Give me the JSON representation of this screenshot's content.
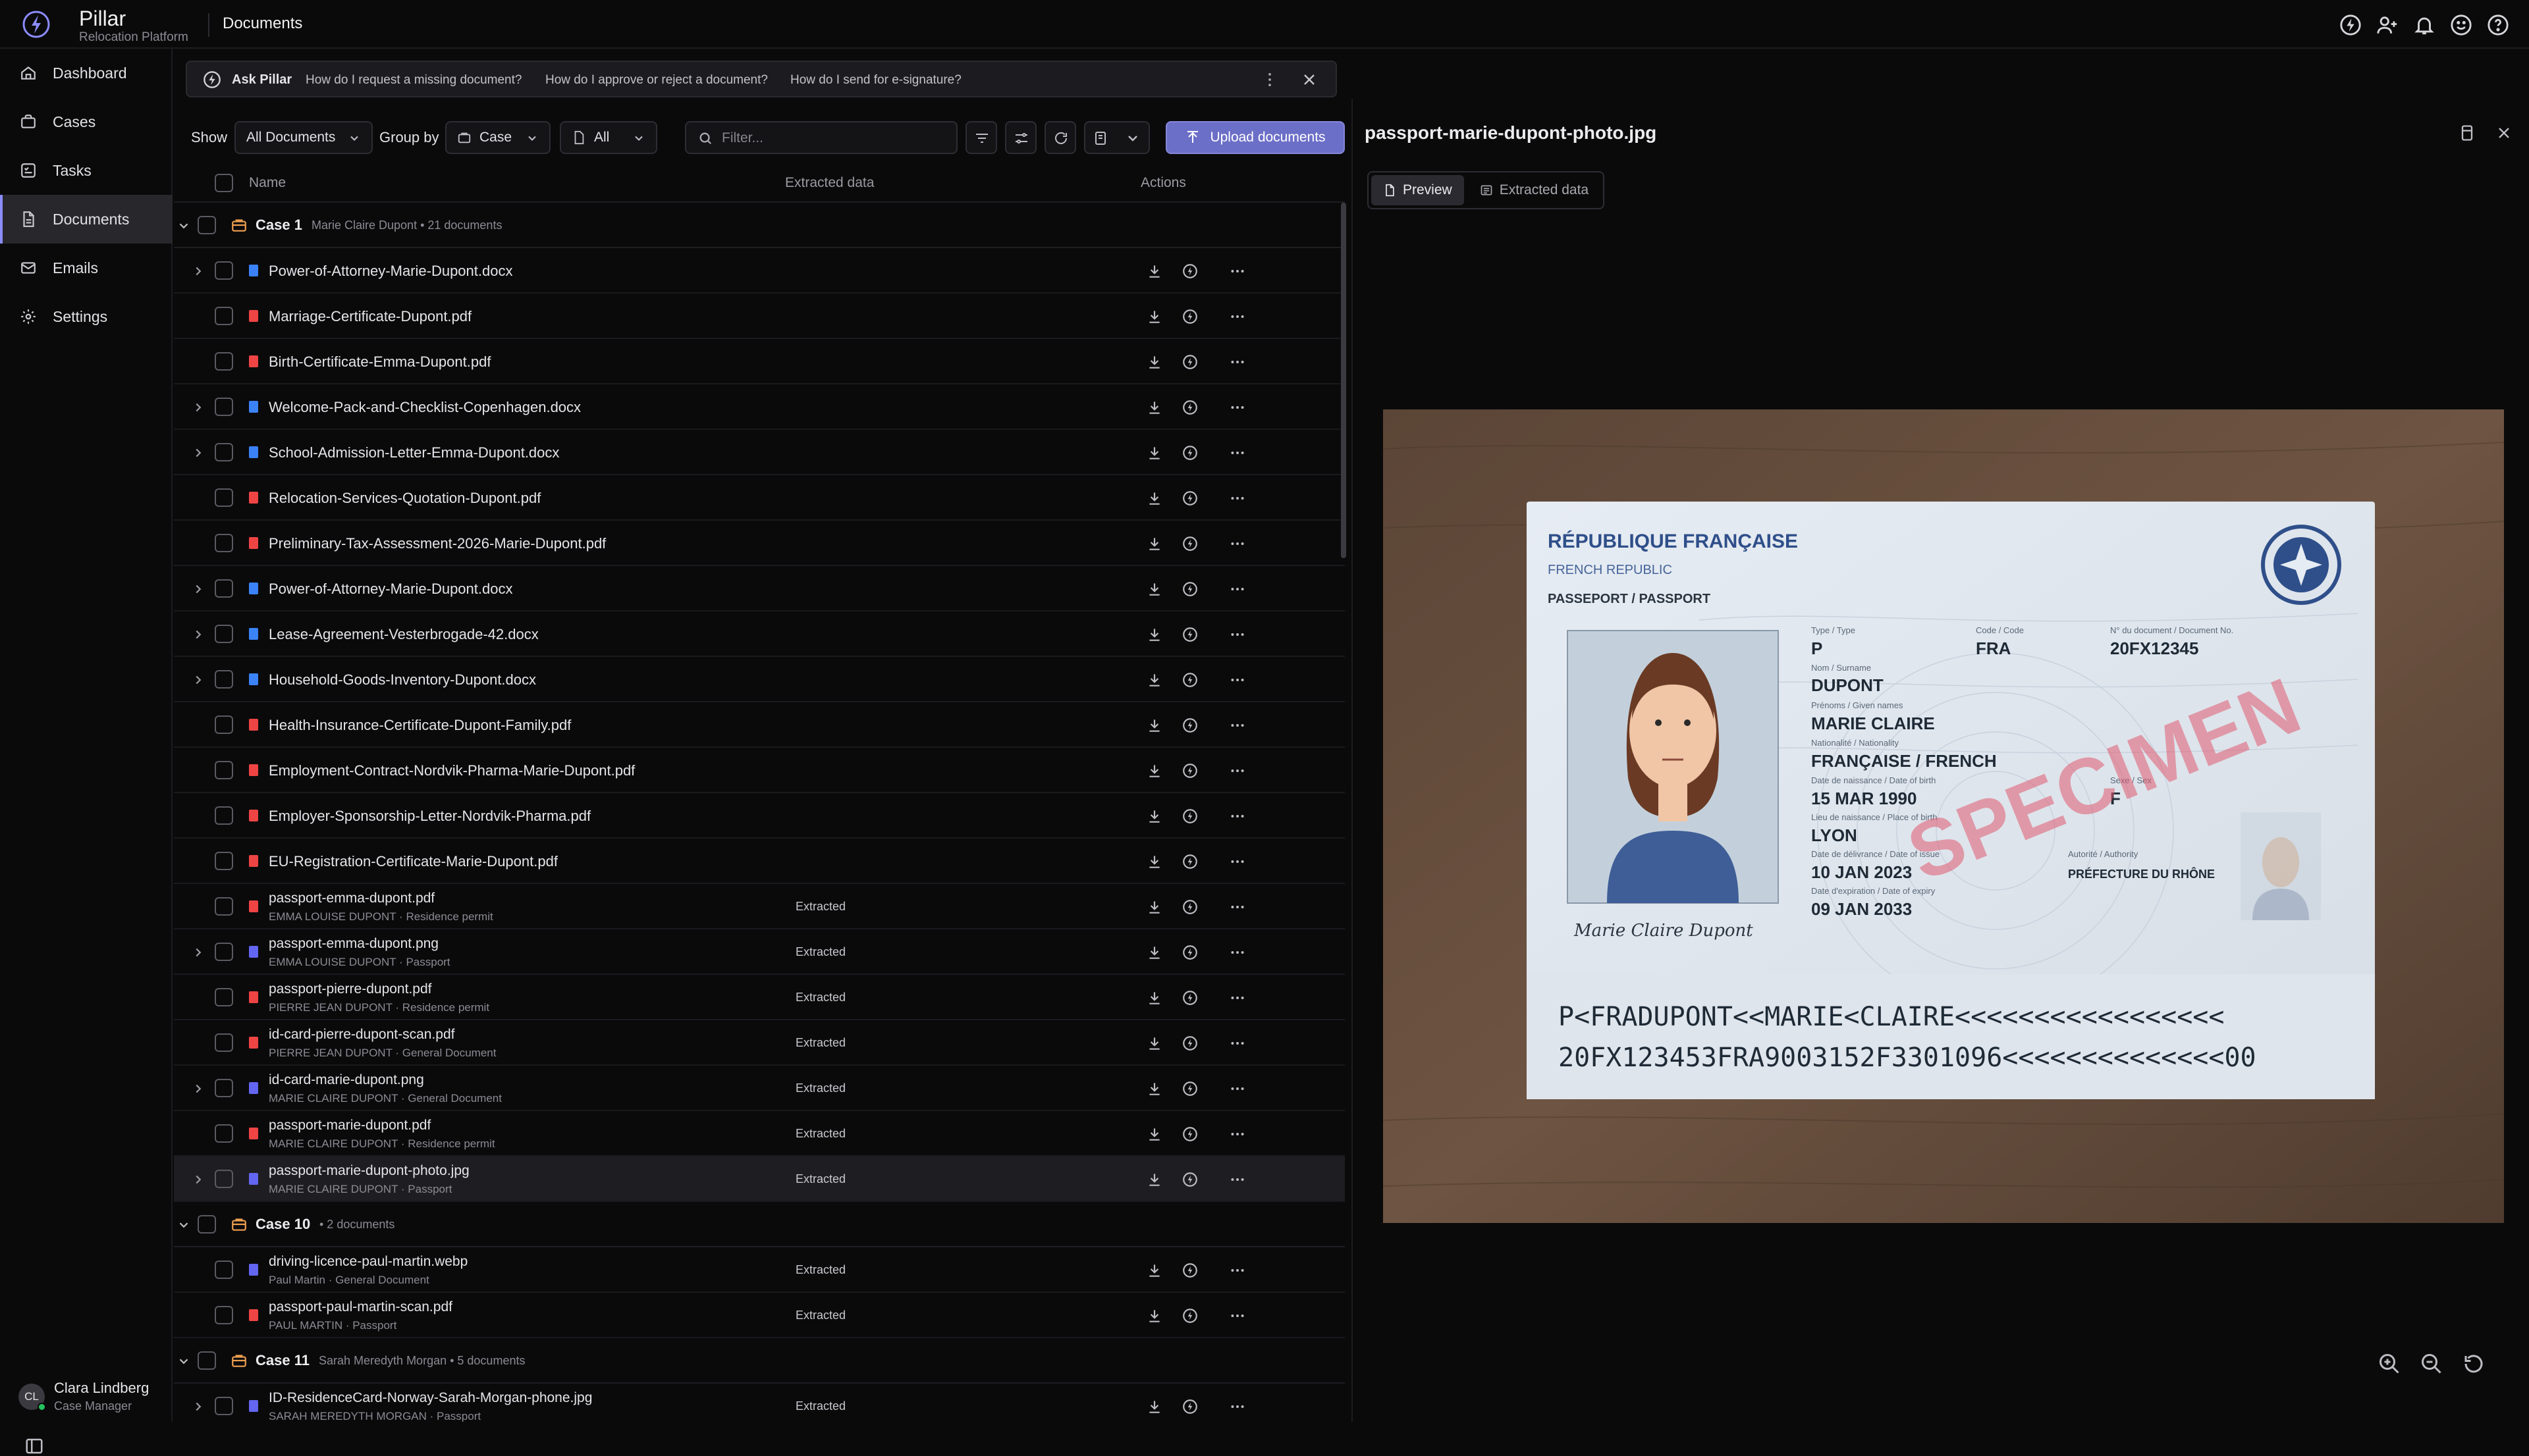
{
  "app": {
    "name": "Pillar",
    "subtitle": "Relocation Platform",
    "page_title": "Documents"
  },
  "top_icons": [
    "pillar-assistant-icon",
    "user-add-icon",
    "bell-icon",
    "smile-icon",
    "help-icon"
  ],
  "sidebar": {
    "items": [
      {
        "label": "Dashboard",
        "icon": "dashboard-icon",
        "active": false
      },
      {
        "label": "Cases",
        "icon": "briefcase-icon",
        "active": false
      },
      {
        "label": "Tasks",
        "icon": "tasks-icon",
        "active": false
      },
      {
        "label": "Documents",
        "icon": "document-icon",
        "active": true
      },
      {
        "label": "Emails",
        "icon": "mail-icon",
        "active": false
      },
      {
        "label": "Settings",
        "icon": "gear-icon",
        "active": false
      }
    ],
    "user": {
      "initials": "CL",
      "name": "Clara Lindberg",
      "role": "Case Manager"
    }
  },
  "ask": {
    "label": "Ask Pillar",
    "questions": [
      "How do I request a missing document?",
      "How do I approve or reject a document?",
      "How do I send for e-signature?"
    ]
  },
  "toolbar": {
    "show_label": "Show",
    "show_value": "All Documents",
    "group_label": "Group by",
    "group_value": "Case",
    "status_value": "All",
    "filter_placeholder": "Filter...",
    "upload_label": "Upload documents"
  },
  "table": {
    "columns": {
      "name": "Name",
      "extracted": "Extracted data",
      "actions": "Actions"
    },
    "groups": [
      {
        "title": "Case 1",
        "meta": "Marie Claire Dupont • 21 documents",
        "rows": [
          {
            "name": "Power-of-Attorney-Marie-Dupont.docx",
            "type": "doc",
            "expandable": true
          },
          {
            "name": "Marriage-Certificate-Dupont.pdf",
            "type": "pdf",
            "expandable": false
          },
          {
            "name": "Birth-Certificate-Emma-Dupont.pdf",
            "type": "pdf",
            "expandable": false
          },
          {
            "name": "Welcome-Pack-and-Checklist-Copenhagen.docx",
            "type": "doc",
            "expandable": true
          },
          {
            "name": "School-Admission-Letter-Emma-Dupont.docx",
            "type": "doc",
            "expandable": true
          },
          {
            "name": "Relocation-Services-Quotation-Dupont.pdf",
            "type": "pdf",
            "expandable": false
          },
          {
            "name": "Preliminary-Tax-Assessment-2026-Marie-Dupont.pdf",
            "type": "pdf",
            "expandable": false
          },
          {
            "name": "Power-of-Attorney-Marie-Dupont.docx",
            "type": "doc",
            "expandable": true
          },
          {
            "name": "Lease-Agreement-Vesterbrogade-42.docx",
            "type": "doc",
            "expandable": true
          },
          {
            "name": "Household-Goods-Inventory-Dupont.docx",
            "type": "doc",
            "expandable": true
          },
          {
            "name": "Health-Insurance-Certificate-Dupont-Family.pdf",
            "type": "pdf",
            "expandable": false
          },
          {
            "name": "Employment-Contract-Nordvik-Pharma-Marie-Dupont.pdf",
            "type": "pdf",
            "expandable": false
          },
          {
            "name": "Employer-Sponsorship-Letter-Nordvik-Pharma.pdf",
            "type": "pdf",
            "expandable": false
          },
          {
            "name": "EU-Registration-Certificate-Marie-Dupont.pdf",
            "type": "pdf",
            "expandable": false
          },
          {
            "name": "passport-emma-dupont.pdf",
            "sub": "EMMA LOUISE DUPONT · Residence permit",
            "type": "pdf",
            "expandable": false,
            "extracted": "Extracted"
          },
          {
            "name": "passport-emma-dupont.png",
            "sub": "EMMA LOUISE DUPONT · Passport",
            "type": "img",
            "expandable": true,
            "extracted": "Extracted"
          },
          {
            "name": "passport-pierre-dupont.pdf",
            "sub": "PIERRE JEAN DUPONT · Residence permit",
            "type": "pdf",
            "expandable": false,
            "extracted": "Extracted"
          },
          {
            "name": "id-card-pierre-dupont-scan.pdf",
            "sub": "PIERRE JEAN DUPONT · General Document",
            "type": "pdf",
            "expandable": false,
            "extracted": "Extracted"
          },
          {
            "name": "id-card-marie-dupont.png",
            "sub": "MARIE CLAIRE DUPONT · General Document",
            "type": "img",
            "expandable": true,
            "extracted": "Extracted"
          },
          {
            "name": "passport-marie-dupont.pdf",
            "sub": "MARIE CLAIRE DUPONT · Residence permit",
            "type": "pdf",
            "expandable": false,
            "extracted": "Extracted"
          },
          {
            "name": "passport-marie-dupont-photo.jpg",
            "sub": "MARIE CLAIRE DUPONT · Passport",
            "type": "img",
            "expandable": true,
            "extracted": "Extracted",
            "selected": true
          }
        ]
      },
      {
        "title": "Case 10",
        "meta": "• 2 documents",
        "rows": [
          {
            "name": "driving-licence-paul-martin.webp",
            "sub": "Paul Martin · General Document",
            "type": "img",
            "expandable": false,
            "extracted": "Extracted"
          },
          {
            "name": "passport-paul-martin-scan.pdf",
            "sub": "PAUL MARTIN · Passport",
            "type": "pdf",
            "expandable": false,
            "extracted": "Extracted"
          }
        ]
      },
      {
        "title": "Case 11",
        "meta": "Sarah Meredyth Morgan • 5 documents",
        "rows": [
          {
            "name": "ID-ResidenceCard-Norway-Sarah-Morgan-phone.jpg",
            "sub": "SARAH MEREDYTH MORGAN · Passport",
            "type": "img",
            "expandable": true,
            "extracted": "Extracted"
          }
        ]
      }
    ]
  },
  "preview": {
    "title": "passport-marie-dupont-photo.jpg",
    "tabs": {
      "preview": "Preview",
      "extracted": "Extracted data"
    },
    "passport": {
      "country": "RÉPUBLIQUE FRANÇAISE",
      "country_en": "FRENCH REPUBLIC",
      "doc_kind": "PASSEPORT / PASSPORT",
      "type_label": "Type / Type",
      "type": "P",
      "code_label": "Code / Code",
      "code": "FRA",
      "docno_label": "N° du document / Document No.",
      "docno": "20FX12345",
      "surname_label": "Nom / Surname",
      "surname": "DUPONT",
      "given_label": "Prénoms / Given names",
      "given": "MARIE CLAIRE",
      "nat_label": "Nationalité / Nationality",
      "nationality": "FRANÇAISE / FRENCH",
      "dob_label": "Date de naissance / Date of birth",
      "dob": "15 MAR 1990",
      "sex_label": "Sexe / Sex",
      "sex": "F",
      "pob_label": "Lieu de naissance / Place of birth",
      "pob": "LYON",
      "issue_label": "Date de délivrance / Date of issue",
      "issue": "10 JAN 2023",
      "auth_label": "Autorité / Authority",
      "authority": "PRÉFECTURE DU RHÔNE",
      "expiry_label": "Date d'expiration / Date of expiry",
      "expiry": "09 JAN 2033",
      "signature": "Marie Claire Dupont",
      "stamp": "SPECIMEN",
      "mrz1": "P<FRADUPONT<<MARIE<CLAIRE<<<<<<<<<<<<<<<<<",
      "mrz2": "20FX123453FRA9003152F3301096<<<<<<<<<<<<<<00"
    }
  }
}
